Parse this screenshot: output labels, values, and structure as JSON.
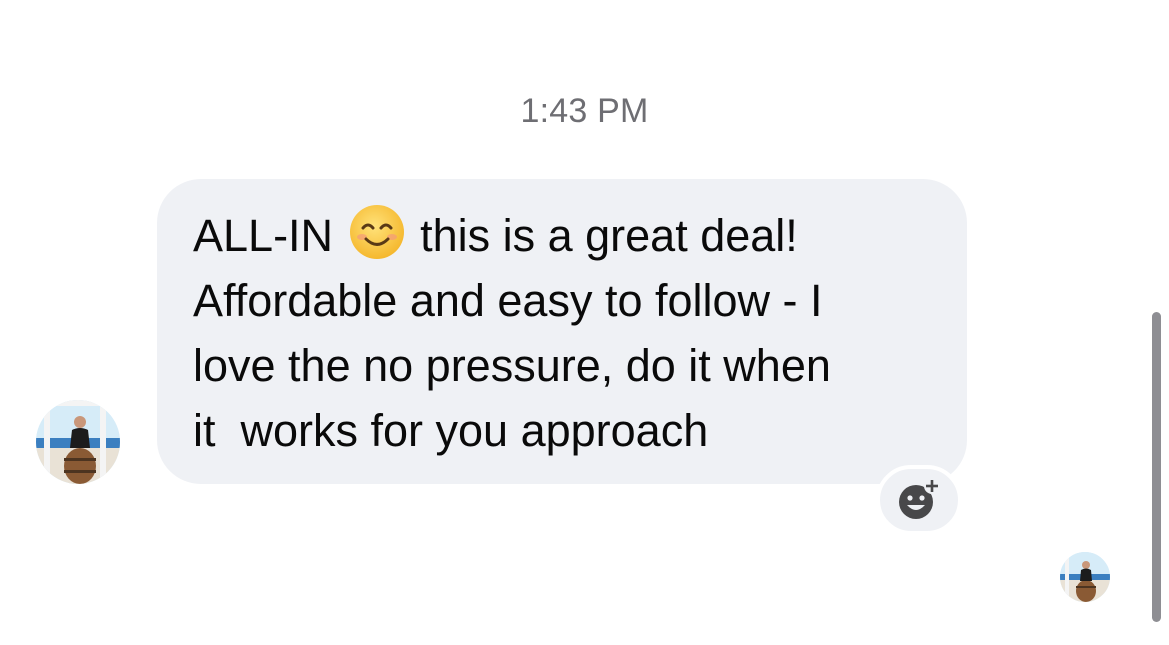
{
  "chat": {
    "timestamp": "1:43 PM",
    "message": {
      "line1_before": "ALL-IN ",
      "line1_after": " this is a great deal!",
      "rest": "\nAffordable and easy to follow - I\nlove the no pressure, do it when\nit  works for you approach",
      "emoji": "smiling-face-with-smiling-eyes",
      "bubble_color": "#eff1f5"
    },
    "add_reaction_icon": "add-reaction-icon",
    "sender_avatar": "avatar",
    "seen_avatar": "seen-avatar"
  }
}
